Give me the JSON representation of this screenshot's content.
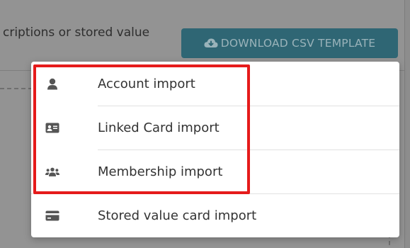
{
  "header": {
    "text": "criptions or stored value",
    "download_button_label": "DOWNLOAD CSV TEMPLATE",
    "download_button_icon": "cloud-download-icon"
  },
  "menu": {
    "items": [
      {
        "label": "Account import",
        "icon": "user-icon"
      },
      {
        "label": "Linked Card import",
        "icon": "id-card-icon"
      },
      {
        "label": "Membership import",
        "icon": "users-group-icon"
      },
      {
        "label": "Stored value card import",
        "icon": "credit-card-icon"
      }
    ]
  },
  "colors": {
    "highlight": "#e51b1b",
    "button_bg": "#2f6674",
    "icon": "#555555"
  }
}
